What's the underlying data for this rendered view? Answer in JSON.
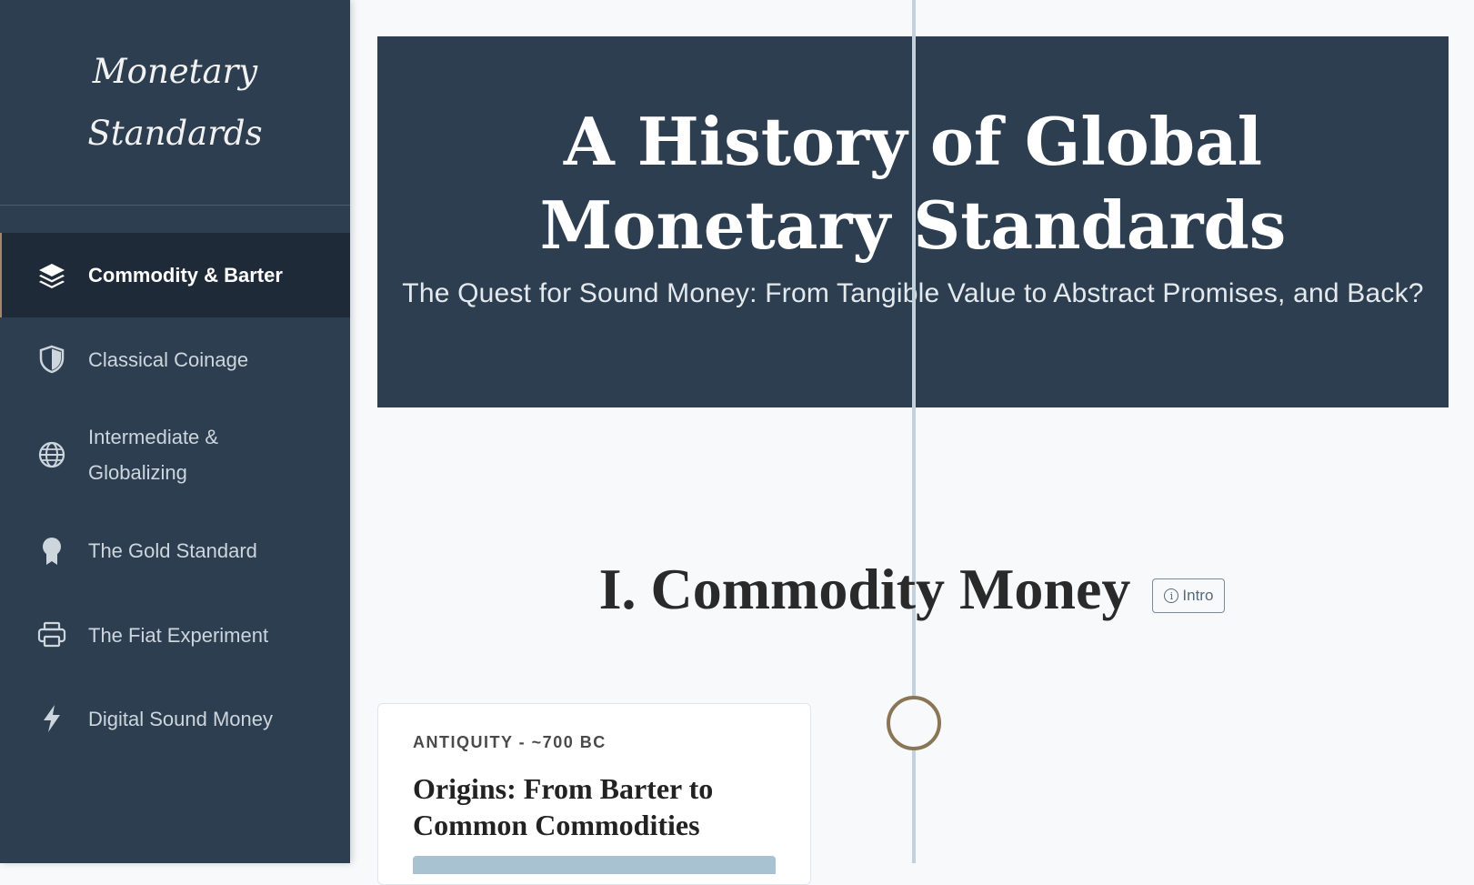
{
  "sidebar": {
    "brand_line1": "Monetary",
    "brand_line2": "Standards",
    "items": [
      {
        "label": "Commodity & Barter",
        "icon": "layers-icon",
        "active": true
      },
      {
        "label": "Classical Coinage",
        "icon": "shield-icon",
        "active": false
      },
      {
        "label": "Intermediate & Globalizing",
        "icon": "globe-icon",
        "active": false
      },
      {
        "label": "The Gold Standard",
        "icon": "award-icon",
        "active": false
      },
      {
        "label": "The Fiat Experiment",
        "icon": "printer-icon",
        "active": false
      },
      {
        "label": "Digital Sound Money",
        "icon": "lightning-icon",
        "active": false
      }
    ]
  },
  "hero": {
    "title": "A History of Global Monetary Standards",
    "subtitle": "The Quest for Sound Money: From Tangible Value to Abstract Promises, and Back?"
  },
  "section": {
    "title": "I. Commodity Money",
    "intro_button": "Intro",
    "intro_icon": "info-icon"
  },
  "timeline": {
    "cards": [
      {
        "date": "ANTIQUITY - ~700 BC",
        "title": "Origins: From Barter to Common Commodities"
      }
    ]
  },
  "colors": {
    "sidebar_bg": "#2c3e50",
    "active_item_bg": "#1e2a37",
    "accent": "#8a7557",
    "page_bg": "#f7f9fb",
    "timeline_line": "#c3d1dc"
  }
}
